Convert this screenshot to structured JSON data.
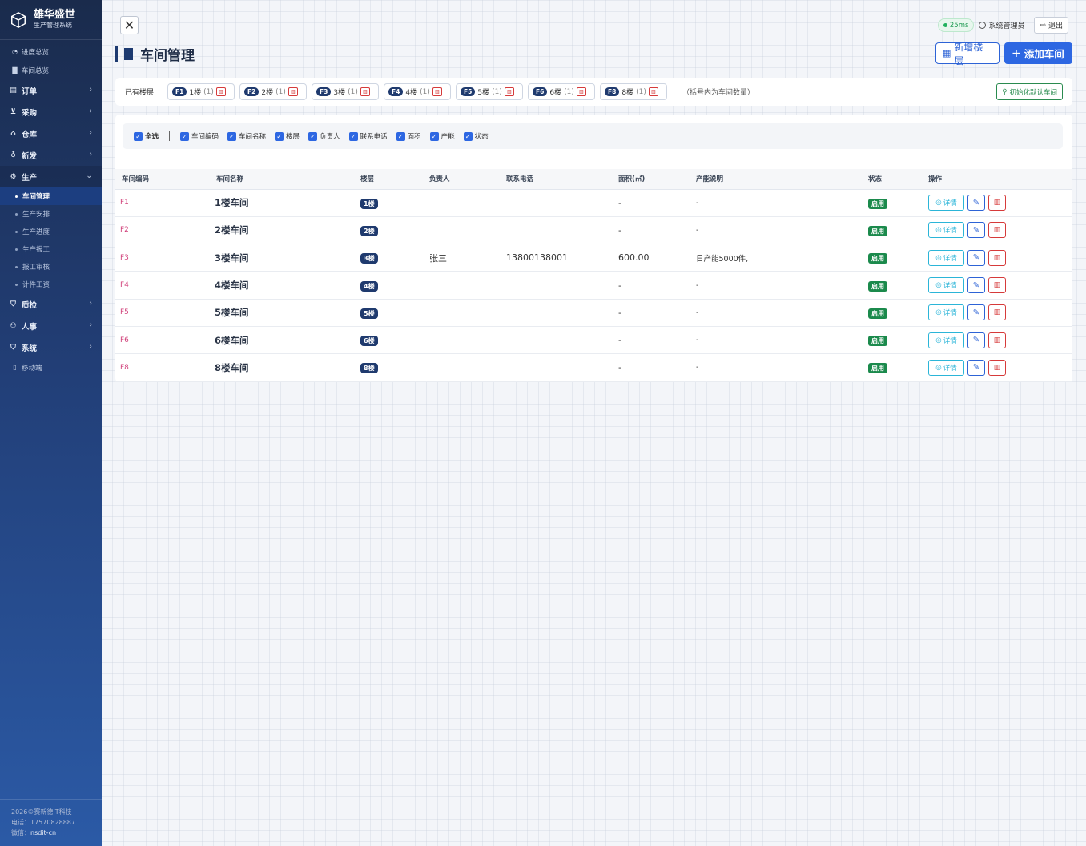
{
  "brand": {
    "title": "雄华盛世",
    "subtitle": "生产管理系统"
  },
  "sidebar": {
    "top_items": [
      {
        "label": "进度总览",
        "icon": "dashboard-icon"
      },
      {
        "label": "车间总览",
        "icon": "building-icon"
      }
    ],
    "groups": [
      {
        "label": "订单",
        "icon": "order-icon"
      },
      {
        "label": "采购",
        "icon": "cart-icon"
      },
      {
        "label": "仓库",
        "icon": "warehouse-icon"
      },
      {
        "label": "新发",
        "icon": "bulb-icon"
      },
      {
        "label": "生产",
        "icon": "gear-icon",
        "open": true,
        "children": [
          "车间管理",
          "生产安排",
          "生产进度",
          "生产报工",
          "报工审核",
          "计件工资"
        ]
      },
      {
        "label": "质检",
        "icon": "shield-check-icon"
      },
      {
        "label": "人事",
        "icon": "people-icon"
      },
      {
        "label": "系统",
        "icon": "shield-icon"
      }
    ],
    "mobile": "移动端",
    "footer": {
      "copyright": "2026©赛新德IT科技",
      "phone": "电话：17570828887",
      "wechat_label": "微信：",
      "wechat": "nsdit-cn"
    }
  },
  "header": {
    "latency": "25ms",
    "user": "系统管理员",
    "logout": "退出",
    "page_title": "车间管理",
    "add_floor": "新增楼层",
    "add_workshop": "添加车间"
  },
  "floors": {
    "label": "已有楼层:",
    "items": [
      {
        "code": "F1",
        "name": "1楼",
        "count": "(1)"
      },
      {
        "code": "F2",
        "name": "2楼",
        "count": "(1)"
      },
      {
        "code": "F3",
        "name": "3楼",
        "count": "(1)"
      },
      {
        "code": "F4",
        "name": "4楼",
        "count": "(1)"
      },
      {
        "code": "F5",
        "name": "5楼",
        "count": "(1)"
      },
      {
        "code": "F6",
        "name": "6楼",
        "count": "(1)"
      },
      {
        "code": "F8",
        "name": "8楼",
        "count": "(1)"
      }
    ],
    "hint": "（括号内为车间数量）",
    "init_button": "初始化默认车间"
  },
  "columns_toggle": {
    "select_all": "全选",
    "items": [
      "车间编码",
      "车间名称",
      "楼层",
      "负责人",
      "联系电话",
      "面积",
      "产能",
      "状态"
    ]
  },
  "table": {
    "headers": [
      "车间编码",
      "车间名称",
      "楼层",
      "负责人",
      "联系电话",
      "面积(㎡)",
      "产能说明",
      "状态",
      "操作"
    ],
    "detail_label": "详情",
    "rows": [
      {
        "code": "F1",
        "name": "1楼车间",
        "floor": "1楼",
        "manager": "",
        "phone": "",
        "area": "-",
        "capacity": "-",
        "status": "启用"
      },
      {
        "code": "F2",
        "name": "2楼车间",
        "floor": "2楼",
        "manager": "",
        "phone": "",
        "area": "-",
        "capacity": "-",
        "status": "启用"
      },
      {
        "code": "F3",
        "name": "3楼车间",
        "floor": "3楼",
        "manager": "张三",
        "phone": "13800138001",
        "area": "600.00",
        "capacity": "日产能5000件,",
        "status": "启用"
      },
      {
        "code": "F4",
        "name": "4楼车间",
        "floor": "4楼",
        "manager": "",
        "phone": "",
        "area": "-",
        "capacity": "-",
        "status": "启用"
      },
      {
        "code": "F5",
        "name": "5楼车间",
        "floor": "5楼",
        "manager": "",
        "phone": "",
        "area": "-",
        "capacity": "-",
        "status": "启用"
      },
      {
        "code": "F6",
        "name": "6楼车间",
        "floor": "6楼",
        "manager": "",
        "phone": "",
        "area": "-",
        "capacity": "-",
        "status": "启用"
      },
      {
        "code": "F8",
        "name": "8楼车间",
        "floor": "8楼",
        "manager": "",
        "phone": "",
        "area": "-",
        "capacity": "-",
        "status": "启用"
      }
    ]
  },
  "colors": {
    "primary": "#2d67e2",
    "sidebar": "#223f78",
    "success": "#1b8a4c",
    "danger": "#d63a3a",
    "info": "#2bb5d8"
  }
}
